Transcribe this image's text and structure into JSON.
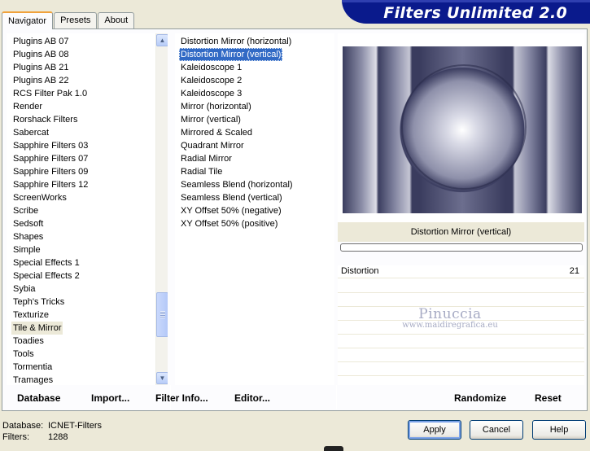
{
  "tabs": [
    "Navigator",
    "Presets",
    "About"
  ],
  "banner_title": "Filters Unlimited 2.0",
  "categories": [
    "Plugins AB 07",
    "Plugins AB 08",
    "Plugins AB 21",
    "Plugins AB 22",
    "RCS Filter Pak 1.0",
    "Render",
    "Rorshack Filters",
    "Sabercat",
    "Sapphire Filters 03",
    "Sapphire Filters 07",
    "Sapphire Filters 09",
    "Sapphire Filters 12",
    "ScreenWorks",
    "Scribe",
    "Sedsoft",
    "Shapes",
    "Simple",
    "Special Effects 1",
    "Special Effects 2",
    "Sybia",
    "Teph's Tricks",
    "Texturize",
    "Tile & Mirror",
    "Toadies",
    "Tools",
    "Tormentia",
    "Tramages"
  ],
  "selected_category": "Tile & Mirror",
  "filters": [
    "Distortion Mirror (horizontal)",
    "Distortion Mirror (vertical)",
    "Kaleidoscope 1",
    "Kaleidoscope 2",
    "Kaleidoscope 3",
    "Mirror (horizontal)",
    "Mirror (vertical)",
    "Mirrored & Scaled",
    "Quadrant Mirror",
    "Radial Mirror",
    "Radial Tile",
    "Seamless Blend (horizontal)",
    "Seamless Blend (vertical)",
    "XY Offset 50% (negative)",
    "XY Offset 50% (positive)"
  ],
  "selected_filter": "Distortion Mirror (vertical)",
  "preview_caption": "Distortion Mirror (vertical)",
  "parameter": {
    "label": "Distortion",
    "value": "21"
  },
  "watermark": {
    "name": "Pinuccia",
    "url": "www.maidiregrafica.eu"
  },
  "toolbar": {
    "database": "Database",
    "import": "Import...",
    "filter_info": "Filter Info...",
    "editor": "Editor...",
    "randomize": "Randomize",
    "reset": "Reset"
  },
  "status": {
    "database_label": "Database:",
    "database_value": "ICNET-Filters",
    "filters_label": "Filters:",
    "filters_value": "1288"
  },
  "buttons": {
    "apply": "Apply",
    "cancel": "Cancel",
    "help": "Help"
  }
}
